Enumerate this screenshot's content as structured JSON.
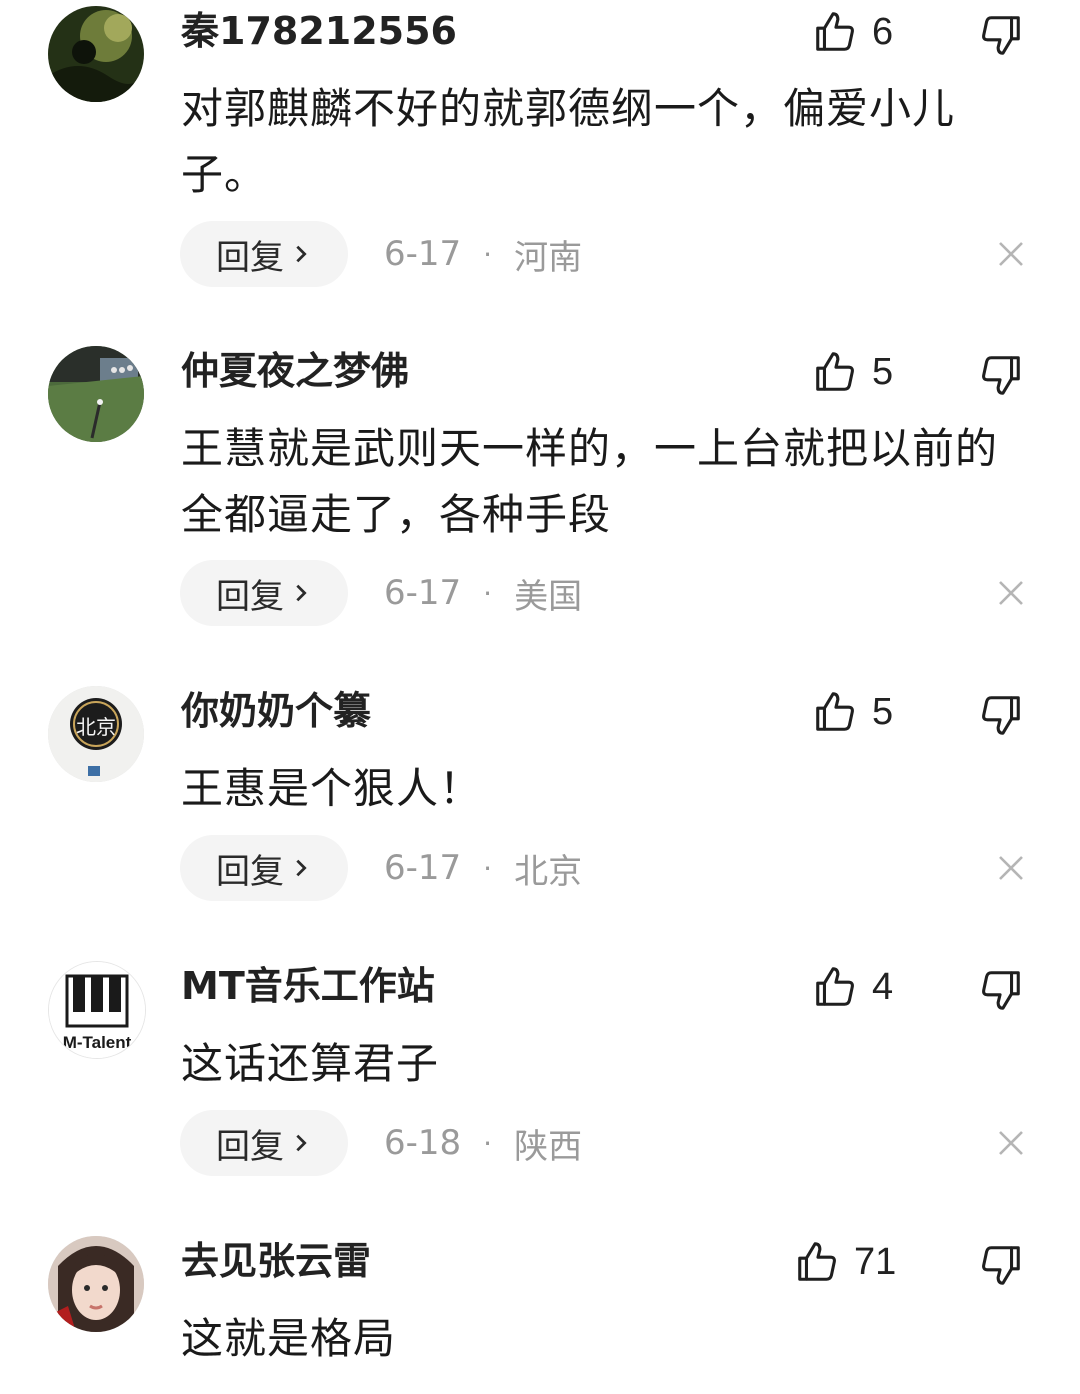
{
  "comments": [
    {
      "username": "秦178212556",
      "likes": "6",
      "text": "对郭麒麟不好的就郭德纲一个，偏爱小儿子。",
      "reply_label": "回复",
      "date": "6-17",
      "location": "河南",
      "avatar": "dark-green-image"
    },
    {
      "username": "仲夏夜之梦佛",
      "likes": "5",
      "text": "王慧就是武则天一样的，一上台就把以前的全都逼走了，各种手段",
      "reply_label": "回复",
      "date": "6-17",
      "location": "美国",
      "avatar": "green-field-image"
    },
    {
      "username": "你奶奶个纂",
      "likes": "5",
      "text": "王惠是个狠人！",
      "reply_label": "回复",
      "date": "6-17",
      "location": "北京",
      "avatar": "beijing-seal-image",
      "avatar_text": "北京"
    },
    {
      "username": "MT音乐工作站",
      "likes": "4",
      "text": "这话还算君子",
      "reply_label": "回复",
      "date": "6-18",
      "location": "陕西",
      "avatar": "m-talent-piano-logo",
      "avatar_text": "M-Talent"
    },
    {
      "username": "去见张云雷",
      "likes": "71",
      "text": "这就是格局",
      "avatar": "portrait-photo"
    }
  ],
  "icons": {
    "like": "thumbs-up-icon",
    "dislike": "thumbs-down-icon",
    "chevron": "chevron-right-icon",
    "close": "close-icon"
  },
  "colors": {
    "text": "#1a1a1a",
    "meta": "#9a9a9a",
    "reply_bg": "#f4f4f4"
  }
}
